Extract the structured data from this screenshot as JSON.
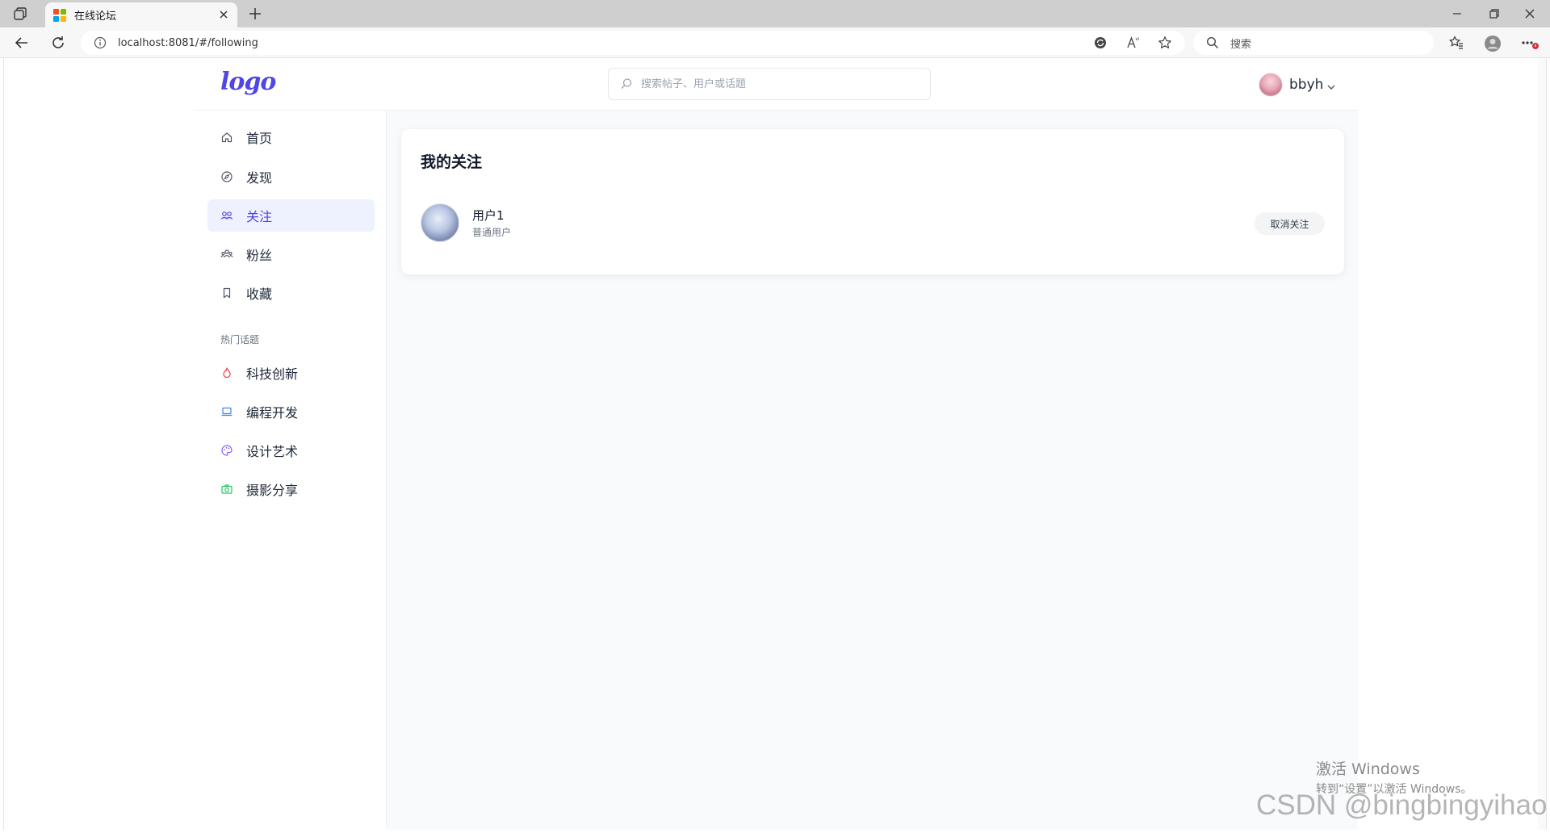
{
  "browser": {
    "tab_title": "在线论坛",
    "url": "localhost:8081/#/following",
    "search_placeholder": "搜索",
    "favicon_colors": [
      "#f25022",
      "#7fba00",
      "#00a4ef",
      "#ffb900"
    ]
  },
  "header": {
    "logo_text": "logo",
    "search_placeholder": "搜索帖子、用户或话题",
    "user_name": "bbyh"
  },
  "sidebar": {
    "items": [
      {
        "label": "首页",
        "icon": "home-icon"
      },
      {
        "label": "发现",
        "icon": "compass-icon"
      },
      {
        "label": "关注",
        "icon": "users-icon",
        "active": true
      },
      {
        "label": "粉丝",
        "icon": "fans-icon"
      },
      {
        "label": "收藏",
        "icon": "bookmark-icon"
      }
    ],
    "topics_title": "热门话题",
    "topics": [
      {
        "label": "科技创新",
        "icon": "flame-icon",
        "color": "#ef4444"
      },
      {
        "label": "编程开发",
        "icon": "laptop-icon",
        "color": "#3b82f6"
      },
      {
        "label": "设计艺术",
        "icon": "palette-icon",
        "color": "#8b5cf6"
      },
      {
        "label": "摄影分享",
        "icon": "camera-icon",
        "color": "#22c55e"
      }
    ]
  },
  "main": {
    "title": "我的关注",
    "following": [
      {
        "name": "用户1",
        "role": "普通用户",
        "action_label": "取消关注"
      }
    ]
  },
  "overlay": {
    "activate_line1": "激活 Windows",
    "activate_line2": "转到“设置”以激活 Windows。",
    "watermark": "CSDN @bingbingyihao"
  },
  "colors": {
    "accent": "#4f46e5",
    "active_bg": "#eef2ff",
    "page_bg": "#f9fafb"
  }
}
